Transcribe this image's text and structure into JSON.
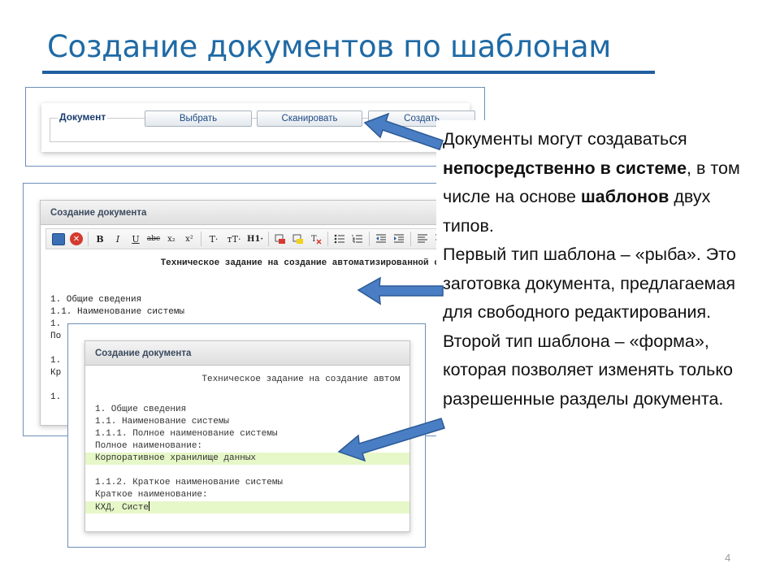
{
  "slide": {
    "title": "Создание документов по шаблонам",
    "page_number": "4"
  },
  "panel1": {
    "legend": "Документ",
    "buttons": [
      "Выбрать",
      "Сканировать",
      "Создать"
    ]
  },
  "panel2": {
    "window_title": "Создание документа",
    "toolbar": {
      "bold": "B",
      "italic": "I",
      "underline": "U",
      "strike": "abc",
      "subscript": "x₂",
      "superscript": "x²",
      "font": "T·",
      "font_size": "тT·",
      "heading": "H1·"
    },
    "doc_title": "Техническое задание на создание автоматизированной системы",
    "lines": [
      "1. Общие сведения",
      "1.1. Наименование системы",
      "1.",
      "По",
      "",
      "1.",
      "Кр",
      "",
      "1."
    ]
  },
  "panel3": {
    "window_title": "Создание документа",
    "doc_title": "Техническое задание на создание автом",
    "l1": "1. Общие сведения",
    "l2": "1.1. Наименование системы",
    "l3": "1.1.1. Полное наименование системы",
    "l4": "Полное наименование:",
    "l5": "Корпоративное хранилище данных",
    "l6": "1.1.2. Краткое наименование системы",
    "l7": "Краткое наименование:",
    "l8": "КХД, Систе"
  },
  "callout": {
    "p1": "Документы могут создаваться ",
    "p1_bold": "непосредственно в системе",
    "p1_end": ", в том числе на основе ",
    "p2_bold": "шаблонов",
    "p2_end": " двух типов.",
    "p3": "Первый тип шаблона – «рыба». Это заготовка документа, предлагаемая для свободного редактирования.",
    "p4": "Второй тип шаблона – «форма»,   которая позволяет изменять только разрешенные  разделы документа."
  },
  "colors": {
    "title": "#1f6aa5",
    "accent_arrow": "#4a7ec4",
    "editable": "#e6f7c8"
  }
}
